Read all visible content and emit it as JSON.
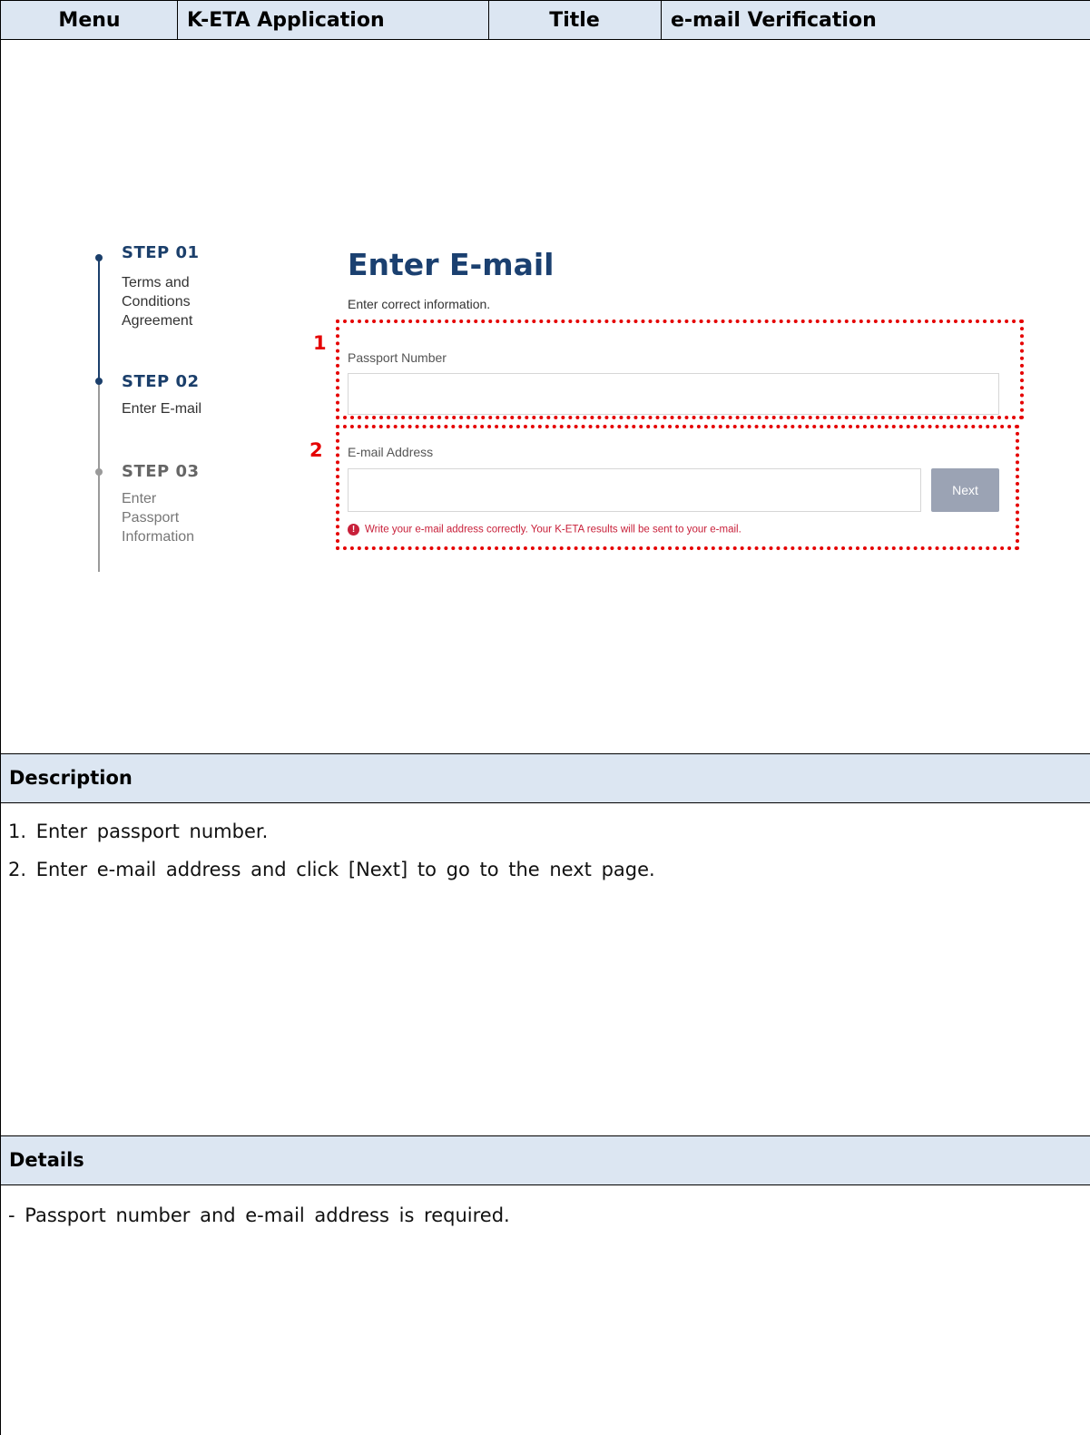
{
  "header": {
    "menu_label": "Menu",
    "menu_value": "K-ETA Application",
    "title_label": "Title",
    "title_value": "e-mail Verification"
  },
  "stepper": {
    "steps": [
      {
        "title": "STEP 01",
        "lines": [
          "Terms and",
          "Conditions",
          "Agreement"
        ]
      },
      {
        "title": "STEP 02",
        "lines": [
          "Enter E-mail"
        ]
      },
      {
        "title": "STEP 03",
        "lines": [
          "Enter",
          "Passport",
          "Information"
        ]
      }
    ]
  },
  "form": {
    "heading": "Enter E-mail",
    "subheading": "Enter correct information.",
    "passport_label": "Passport Number",
    "passport_value": "",
    "email_label": "E-mail Address",
    "email_value": "",
    "next_label": "Next",
    "warning_icon": "!",
    "warning_text": "Write your e-mail address correctly. Your K-ETA results will be sent to your e-mail."
  },
  "annotations": {
    "marker_1": "1",
    "marker_2": "2",
    "highlight_color": "#e50000"
  },
  "description": {
    "label": "Description",
    "items": [
      "1. Enter passport number.",
      "2. Enter e-mail address and click [Next] to go to the next page."
    ]
  },
  "details": {
    "label": "Details",
    "items": [
      "- Passport number and e-mail address is required."
    ]
  }
}
